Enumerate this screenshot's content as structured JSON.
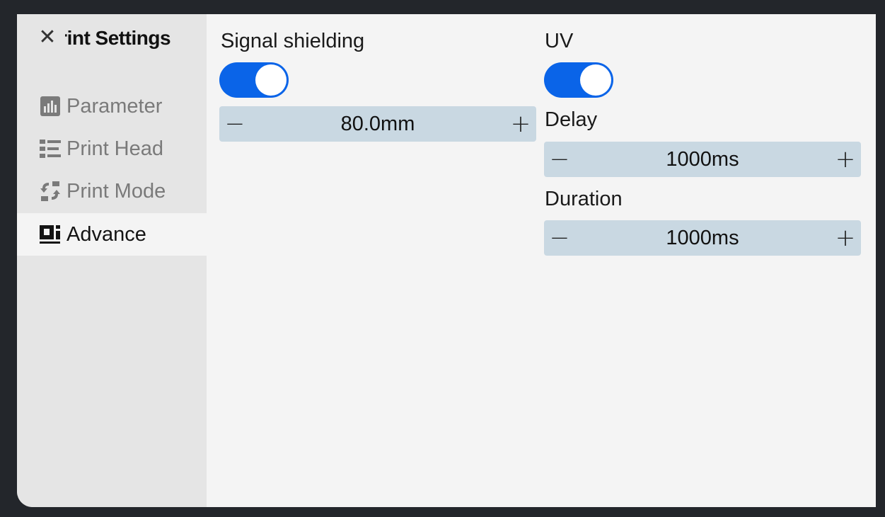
{
  "header": {
    "title": "Print Settings",
    "close_icon": "close-icon"
  },
  "sidebar": {
    "items": [
      {
        "label": "Parameter",
        "icon": "bar-chart-icon",
        "active": false
      },
      {
        "label": "Print Head",
        "icon": "list-icon",
        "active": false
      },
      {
        "label": "Print Mode",
        "icon": "swap-icon",
        "active": false
      },
      {
        "label": "Advance",
        "icon": "advance-icon",
        "active": true
      }
    ]
  },
  "signal_shielding": {
    "label": "Signal shielding",
    "enabled": true,
    "value": "80.0mm"
  },
  "uv": {
    "label": "UV",
    "enabled": true,
    "delay": {
      "label": "Delay",
      "value": "1000ms"
    },
    "duration": {
      "label": "Duration",
      "value": "1000ms"
    }
  },
  "stepper": {
    "minus": "−",
    "plus": "+"
  },
  "colors": {
    "accent": "#0a64e8",
    "stepper_bg": "#c9d8e2",
    "sidebar_bg": "#e5e5e5",
    "content_bg": "#f4f4f4"
  }
}
